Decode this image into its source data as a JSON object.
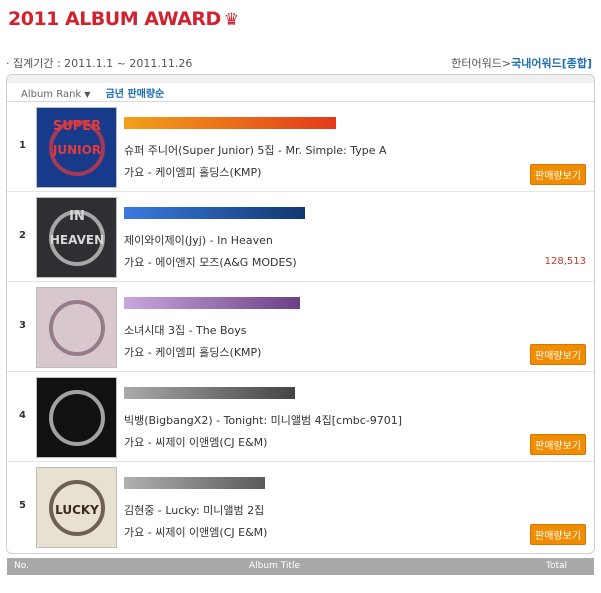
{
  "title": "2011 ALBUM AWARD",
  "crown_icon": "crown-icon",
  "period": "· 집계기간 : 2011.1.1 ~ 2011.11.26",
  "breadcrumb": {
    "parent": "한터어워드",
    "separator": ">",
    "current": "국내어워드[종합]"
  },
  "rank_selector": {
    "label": "Album Rank",
    "sort": "금년 판매량순"
  },
  "items": [
    {
      "rank": "1",
      "title": "슈퍼 주니어(Super Junior) 5집 - Mr. Simple: Type A",
      "meta": "가요 - 케이엠피 홀딩스(KMP)",
      "action": "판매량보기",
      "sales": "",
      "bar_level": 0.84,
      "bar_color_from": "#f2a11a",
      "bar_color_to": "#e23a1a",
      "cover_bg": "#173a8a",
      "cover_fg": "#e43a3a",
      "cover_text_1": "SUPER",
      "cover_text_2": "JUNIOR"
    },
    {
      "rank": "2",
      "title": "제이와이제이(Jyj) - In Heaven",
      "meta": "가요 - 에이앤지 모즈(A&G MODES)",
      "action": "",
      "sales": "128,513",
      "bar_level": 0.72,
      "bar_color_from": "#3a7ae0",
      "bar_color_to": "#12386f",
      "cover_bg": "#2f2f33",
      "cover_fg": "#d8d8d8",
      "cover_text_1": "IN",
      "cover_text_2": "HEAVEN"
    },
    {
      "rank": "3",
      "title": "소녀시대 3집 - The Boys",
      "meta": "가요 - 케이엠피 홀딩스(KMP)",
      "action": "판매량보기",
      "sales": "",
      "bar_level": 0.7,
      "bar_color_from": "#c9a7df",
      "bar_color_to": "#6c3f86",
      "cover_bg": "#d8c7cc",
      "cover_fg": "#7b5b6b",
      "cover_text_1": "",
      "cover_text_2": ""
    },
    {
      "rank": "4",
      "title": "빅뱅(BigbangX2) - Tonight: 미니앨범 4집[cmbc-9701]",
      "meta": "가요 - 씨제이 이앤엠(CJ E&M)",
      "action": "판매량보기",
      "sales": "",
      "bar_level": 0.68,
      "bar_color_from": "#aaaaaa",
      "bar_color_to": "#444444",
      "cover_bg": "#111111",
      "cover_fg": "#e0e0e0",
      "cover_text_1": "",
      "cover_text_2": ""
    },
    {
      "rank": "5",
      "title": "김현중 - Lucky: 미니앨범 2집",
      "meta": "가요 - 씨제이 이앤엠(CJ E&M)",
      "action": "판매량보기",
      "sales": "",
      "bar_level": 0.56,
      "bar_color_from": "#b0b0b0",
      "bar_color_to": "#5a5a5a",
      "cover_bg": "#e8e0d0",
      "cover_fg": "#3b2b1b",
      "cover_text_1": "",
      "cover_text_2": "LUCKY"
    }
  ],
  "footer": {
    "no": "No.",
    "album_title": "Album Title",
    "total": "Total"
  }
}
